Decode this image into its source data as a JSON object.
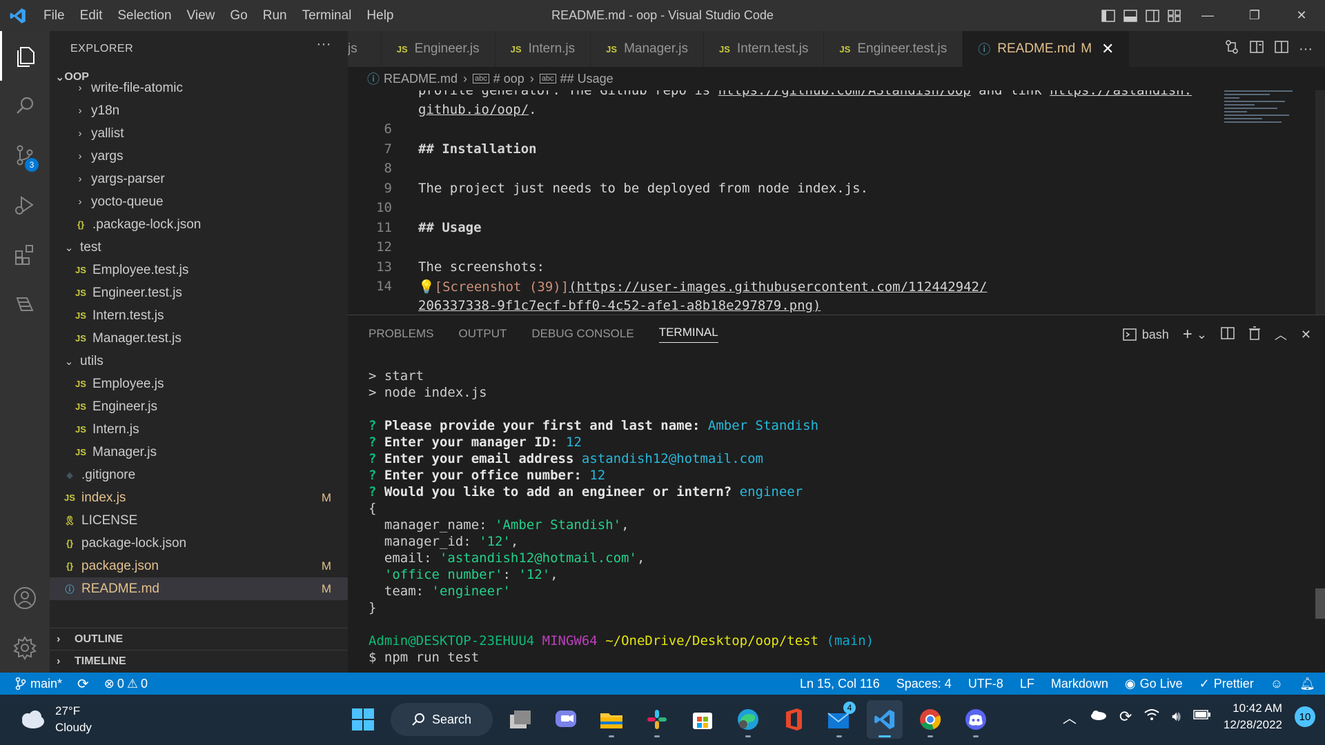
{
  "window": {
    "title": "README.md - oop - Visual Studio Code",
    "menu": [
      "File",
      "Edit",
      "Selection",
      "View",
      "Go",
      "Run",
      "Terminal",
      "Help"
    ]
  },
  "activity": {
    "scm_badge": "3"
  },
  "sidebar": {
    "header": "EXPLORER",
    "more": "···",
    "project": "OOP",
    "items": [
      {
        "label": "write-file-atomic",
        "kind": "folder",
        "depth": 1
      },
      {
        "label": "y18n",
        "kind": "folder",
        "depth": 1
      },
      {
        "label": "yallist",
        "kind": "folder",
        "depth": 1
      },
      {
        "label": "yargs",
        "kind": "folder",
        "depth": 1
      },
      {
        "label": "yargs-parser",
        "kind": "folder",
        "depth": 1
      },
      {
        "label": "yocto-queue",
        "kind": "folder",
        "depth": 1
      },
      {
        "label": ".package-lock.json",
        "kind": "json",
        "depth": 1
      },
      {
        "label": "test",
        "kind": "open-folder",
        "depth": 0
      },
      {
        "label": "Employee.test.js",
        "kind": "js",
        "depth": 1
      },
      {
        "label": "Engineer.test.js",
        "kind": "js",
        "depth": 1
      },
      {
        "label": "Intern.test.js",
        "kind": "js",
        "depth": 1
      },
      {
        "label": "Manager.test.js",
        "kind": "js",
        "depth": 1
      },
      {
        "label": "utils",
        "kind": "open-folder",
        "depth": 0
      },
      {
        "label": "Employee.js",
        "kind": "js",
        "depth": 1
      },
      {
        "label": "Engineer.js",
        "kind": "js",
        "depth": 1
      },
      {
        "label": "Intern.js",
        "kind": "js",
        "depth": 1
      },
      {
        "label": "Manager.js",
        "kind": "js",
        "depth": 1
      },
      {
        "label": ".gitignore",
        "kind": "git",
        "depth": 0
      },
      {
        "label": "index.js",
        "kind": "js",
        "depth": 0,
        "status": "M"
      },
      {
        "label": "LICENSE",
        "kind": "license",
        "depth": 0
      },
      {
        "label": "package-lock.json",
        "kind": "json",
        "depth": 0
      },
      {
        "label": "package.json",
        "kind": "json",
        "depth": 0,
        "status": "M"
      },
      {
        "label": "README.md",
        "kind": "info",
        "depth": 0,
        "status": "M",
        "selected": true
      }
    ],
    "outline": "OUTLINE",
    "timeline": "TIMELINE"
  },
  "tabs": [
    {
      "label": "js",
      "kind": "partial"
    },
    {
      "label": "Engineer.js",
      "kind": "js"
    },
    {
      "label": "Intern.js",
      "kind": "js"
    },
    {
      "label": "Manager.js",
      "kind": "js"
    },
    {
      "label": "Intern.test.js",
      "kind": "js"
    },
    {
      "label": "Engineer.test.js",
      "kind": "js"
    },
    {
      "label": "README.md",
      "kind": "info",
      "active": true,
      "status": "M"
    }
  ],
  "breadcrumb": {
    "file": "README.md",
    "section1": "# oop",
    "section2": "## Usage"
  },
  "editor": {
    "line_a_text": "profile generator. The Github repo is ",
    "line_a_url1": "https://github.com/AStandish/oop",
    "line_a_mid": " and link ",
    "line_a_url2": "https://astandish.",
    "line_b_url": "github.io/oop/",
    "line_b_end": ".",
    "ln6": "6",
    "ln7": "7",
    "l7": "## Installation",
    "ln8": "8",
    "ln9": "9",
    "l9": "The project just needs to be deployed from node index.js.",
    "ln10": "10",
    "ln11": "11",
    "l11": "## Usage",
    "ln12": "12",
    "ln13": "13",
    "l13": "The screenshots:",
    "ln14": "14",
    "l14_alt": "[Screenshot (39)]",
    "l14_url": "(https://user-images.githubusercontent.com/112442942/",
    "l14_cont": "206337338-9f1c7ecf-bff0-4c52-afe1-a8b18e297879.png)"
  },
  "panel": {
    "tabs": [
      "PROBLEMS",
      "OUTPUT",
      "DEBUG CONSOLE",
      "TERMINAL"
    ],
    "active_tab": "TERMINAL",
    "shell": "bash"
  },
  "terminal": {
    "l1": "> start",
    "l2": "> node index.js",
    "q1": "Please provide your first and last name:",
    "a1": "Amber Standish",
    "q2": "Enter your manager ID:",
    "a2": "12",
    "q3": "Enter your email address",
    "a3": "astandish12@hotmail.com",
    "q4": "Enter your office number:",
    "a4": "12",
    "q5": "Would you like to add an engineer or intern?",
    "a5": "engineer",
    "obj_open": "{",
    "k1": "  manager_name: ",
    "v1": "'Amber Standish'",
    "k2": "  manager_id: ",
    "v2": "'12'",
    "k3": "  email: ",
    "v3": "'astandish12@hotmail.com'",
    "k4": "'office number'",
    "v4": "'12'",
    "k5": "  team: ",
    "v5": "'engineer'",
    "obj_close": "}",
    "prompt_user": "Admin@DESKTOP-23EHUU4",
    "prompt_env": "MINGW64",
    "prompt_path": "~/OneDrive/Desktop/oop/test",
    "prompt_branch": "(main)",
    "cmd": "$ npm run test"
  },
  "statusbar": {
    "branch": "main*",
    "errors": "0",
    "warnings": "0",
    "position": "Ln 15, Col 116",
    "spaces": "Spaces: 4",
    "encoding": "UTF-8",
    "eol": "LF",
    "language": "Markdown",
    "golive": "Go Live",
    "prettier": "Prettier"
  },
  "taskbar": {
    "temp": "27°F",
    "condition": "Cloudy",
    "search": "Search",
    "mail_badge": "4",
    "time": "10:42 AM",
    "date": "12/28/2022",
    "notifications": "10"
  },
  "colors": {
    "accent": "#007acc",
    "activity_bar": "#333333",
    "sidebar": "#252526",
    "editor": "#1e1e1e",
    "modified": "#e2c08d"
  }
}
